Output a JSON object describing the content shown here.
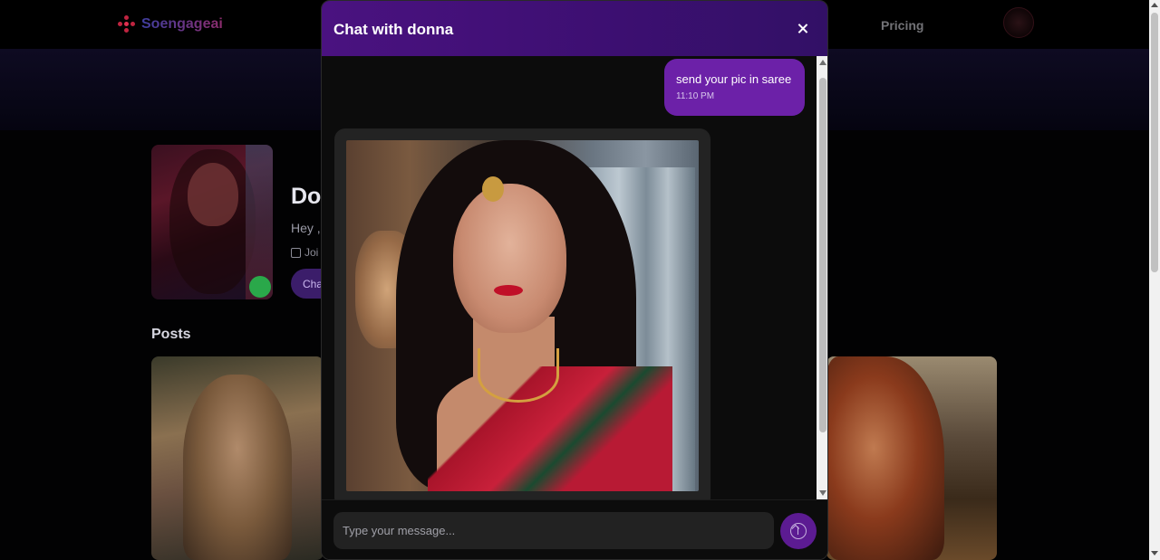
{
  "navbar": {
    "brand": "Soengageai",
    "pricing_label": "Pricing"
  },
  "profile": {
    "name": "Do",
    "bio": "Hey ,",
    "joined": "Joi",
    "chat_button": "Cha"
  },
  "posts": {
    "title": "Posts"
  },
  "chat": {
    "title": "Chat with donna",
    "messages": [
      {
        "sender": "user",
        "text": "send your pic in saree",
        "time": "11:10 PM"
      },
      {
        "sender": "bot",
        "type": "image"
      }
    ],
    "input_placeholder": "Type your message...",
    "colors": {
      "header": "#4a1280",
      "user_bubble": "#6c21a8",
      "send_button": "#5c1b92"
    }
  },
  "icons": {
    "close": "close-icon",
    "send": "arrow-up-circle-icon",
    "calendar": "calendar-icon",
    "brand": "dots-logo-icon"
  }
}
